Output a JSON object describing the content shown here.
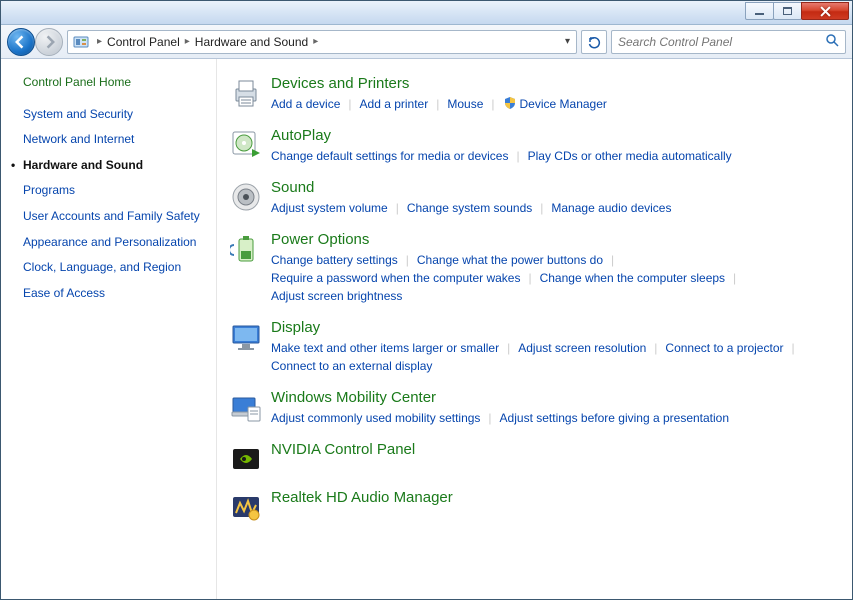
{
  "breadcrumb": {
    "items": [
      "Control Panel",
      "Hardware and Sound"
    ]
  },
  "search": {
    "placeholder": "Search Control Panel"
  },
  "sidebar": {
    "home": "Control Panel Home",
    "items": [
      "System and Security",
      "Network and Internet",
      "Hardware and Sound",
      "Programs",
      "User Accounts and Family Safety",
      "Appearance and Personalization",
      "Clock, Language, and Region",
      "Ease of Access"
    ],
    "current_index": 2
  },
  "categories": [
    {
      "title": "Devices and Printers",
      "links": [
        "Add a device",
        "Add a printer",
        "Mouse",
        "Device Manager"
      ],
      "shield_indices": [
        3
      ]
    },
    {
      "title": "AutoPlay",
      "links": [
        "Change default settings for media or devices",
        "Play CDs or other media automatically"
      ]
    },
    {
      "title": "Sound",
      "links": [
        "Adjust system volume",
        "Change system sounds",
        "Manage audio devices"
      ]
    },
    {
      "title": "Power Options",
      "links": [
        "Change battery settings",
        "Change what the power buttons do",
        "Require a password when the computer wakes",
        "Change when the computer sleeps",
        "Adjust screen brightness"
      ]
    },
    {
      "title": "Display",
      "links": [
        "Make text and other items larger or smaller",
        "Adjust screen resolution",
        "Connect to a projector",
        "Connect to an external display"
      ]
    },
    {
      "title": "Windows Mobility Center",
      "links": [
        "Adjust commonly used mobility settings",
        "Adjust settings before giving a presentation"
      ]
    },
    {
      "title": "NVIDIA Control Panel",
      "links": []
    },
    {
      "title": "Realtek HD Audio Manager",
      "links": []
    }
  ],
  "icons": [
    "printer-icon",
    "autoplay-icon",
    "speaker-icon",
    "battery-icon",
    "display-icon",
    "mobility-icon",
    "nvidia-icon",
    "realtek-icon"
  ]
}
